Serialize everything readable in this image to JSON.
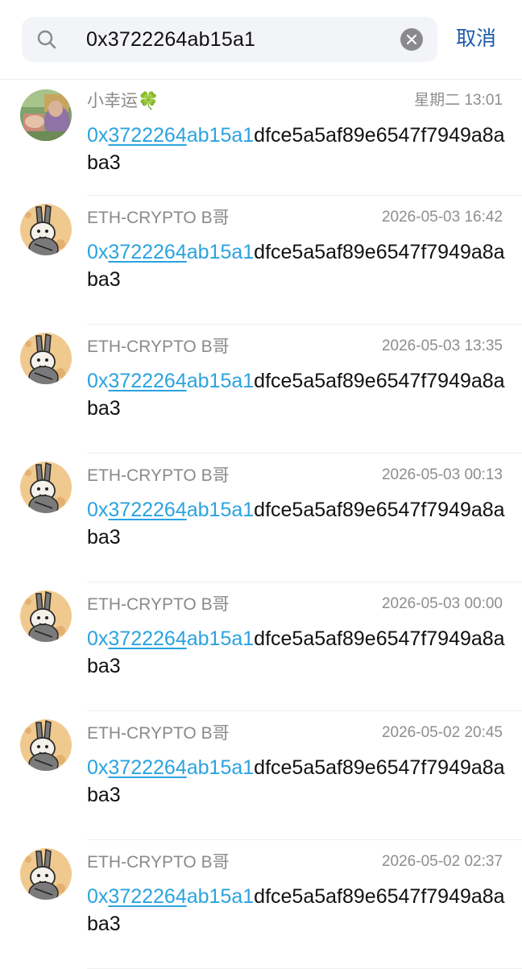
{
  "search": {
    "query": "0x3722264ab15a1",
    "cancel_label": "取消"
  },
  "colors": {
    "highlight": "#2aa3e0",
    "cancel": "#1e5aa8",
    "search_bg": "#f3f4f8"
  },
  "results": [
    {
      "sender": "小幸运🍀",
      "time": "星期二 13:01",
      "avatar": "photo-avatar",
      "msg_prefix": "0x",
      "msg_link": "3722264",
      "msg_match": "ab15a1",
      "msg_rest": "dfce5a5af89e6547f7949a8aba3"
    },
    {
      "sender": "ETH-CRYPTO B哥",
      "time": "2026-05-03 16:42",
      "avatar": "rabbit-avatar",
      "msg_prefix": "0x",
      "msg_link": "3722264",
      "msg_match": "ab15a1",
      "msg_rest": "dfce5a5af89e6547f7949a8aba3"
    },
    {
      "sender": "ETH-CRYPTO B哥",
      "time": "2026-05-03 13:35",
      "avatar": "rabbit-avatar",
      "msg_prefix": "0x",
      "msg_link": "3722264",
      "msg_match": "ab15a1",
      "msg_rest": "dfce5a5af89e6547f7949a8aba3"
    },
    {
      "sender": "ETH-CRYPTO B哥",
      "time": "2026-05-03 00:13",
      "avatar": "rabbit-avatar",
      "msg_prefix": "0x",
      "msg_link": "3722264",
      "msg_match": "ab15a1",
      "msg_rest": "dfce5a5af89e6547f7949a8aba3"
    },
    {
      "sender": "ETH-CRYPTO B哥",
      "time": "2026-05-03 00:00",
      "avatar": "rabbit-avatar",
      "msg_prefix": "0x",
      "msg_link": "3722264",
      "msg_match": "ab15a1",
      "msg_rest": "dfce5a5af89e6547f7949a8aba3"
    },
    {
      "sender": "ETH-CRYPTO B哥",
      "time": "2026-05-02 20:45",
      "avatar": "rabbit-avatar",
      "msg_prefix": "0x",
      "msg_link": "3722264",
      "msg_match": "ab15a1",
      "msg_rest": "dfce5a5af89e6547f7949a8aba3"
    },
    {
      "sender": "ETH-CRYPTO B哥",
      "time": "2026-05-02 02:37",
      "avatar": "rabbit-avatar",
      "msg_prefix": "0x",
      "msg_link": "3722264",
      "msg_match": "ab15a1",
      "msg_rest": "dfce5a5af89e6547f7949a8aba3"
    }
  ]
}
